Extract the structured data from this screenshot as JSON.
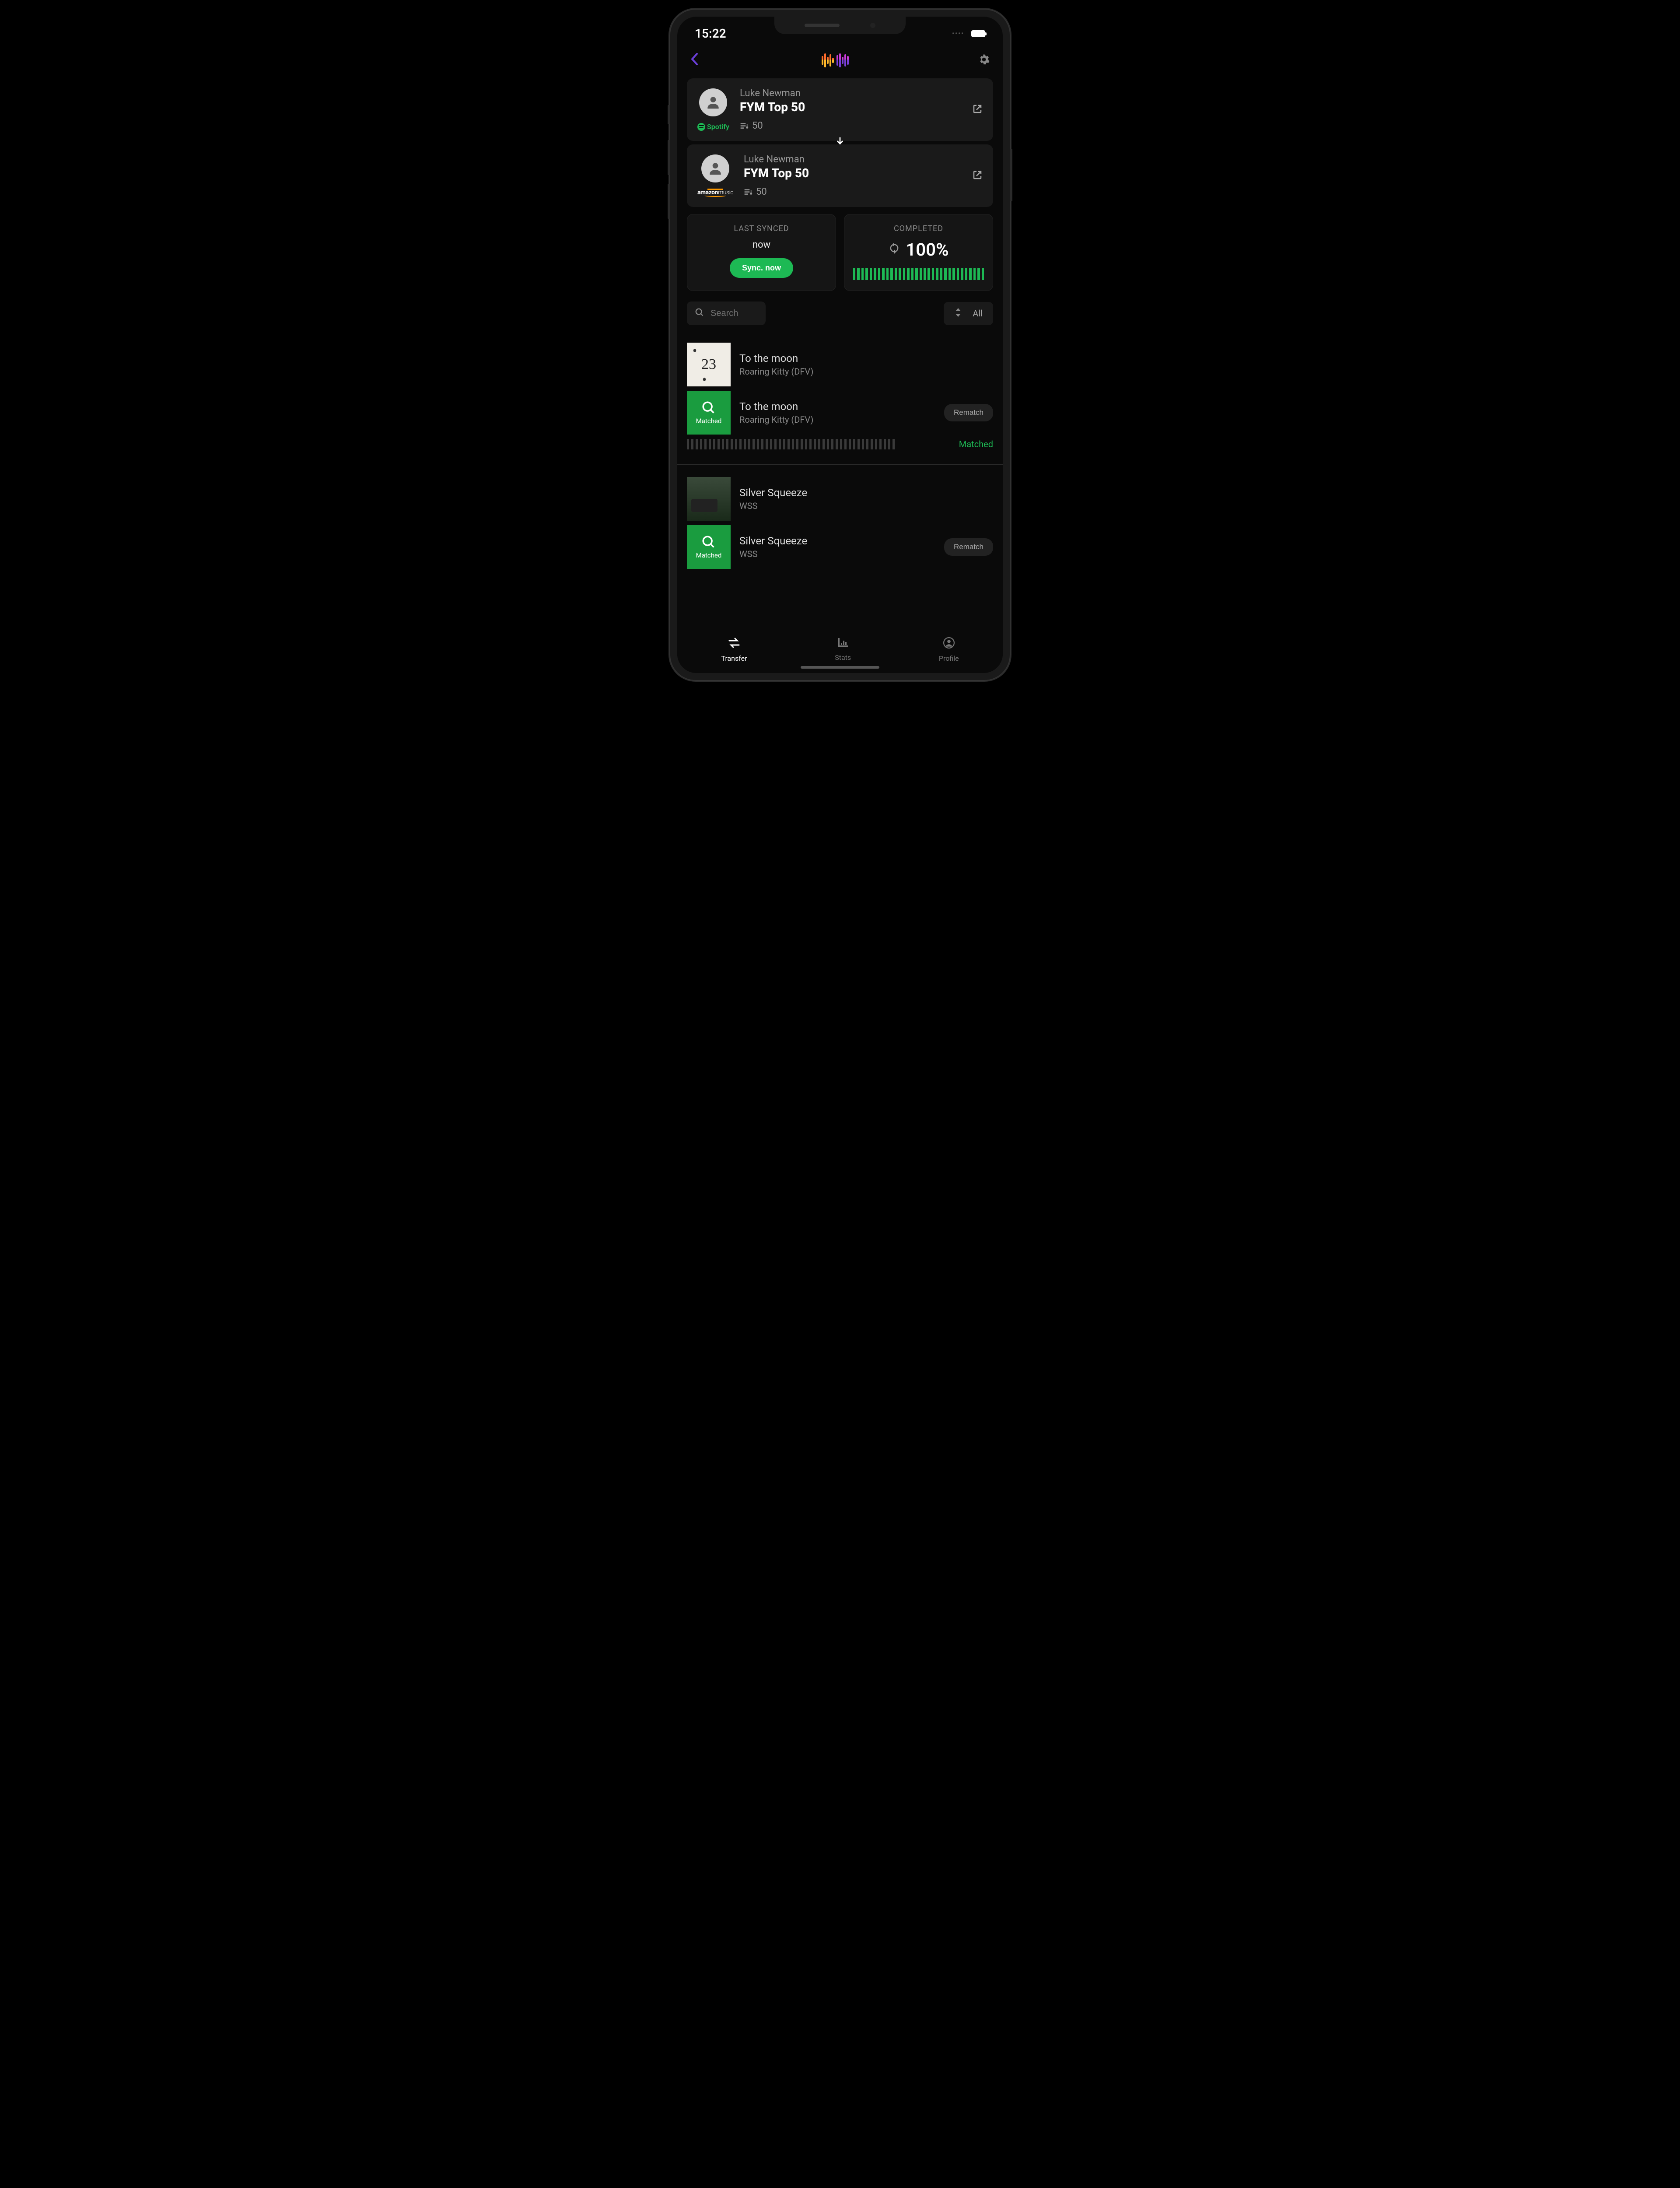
{
  "status_bar": {
    "time": "15:22"
  },
  "source_playlist": {
    "owner": "Luke Newman",
    "name": "FYM Top 50",
    "track_count": "50",
    "service": "Spotify"
  },
  "dest_playlist": {
    "owner": "Luke Newman",
    "name": "FYM Top 50",
    "track_count": "50",
    "service": "amazon music"
  },
  "sync": {
    "last_synced_label": "LAST SYNCED",
    "last_synced_value": "now",
    "sync_button": "Sync. now",
    "completed_label": "COMPLETED",
    "completed_value": "100%"
  },
  "search": {
    "placeholder": "Search",
    "filter_label": "All"
  },
  "tracks": [
    {
      "source": {
        "title": "To the moon",
        "artist": "Roaring Kitty (DFV)"
      },
      "matched": {
        "title": "To the moon",
        "artist": "Roaring Kitty (DFV)",
        "badge": "Matched"
      },
      "rematch_label": "Rematch",
      "status": "Matched"
    },
    {
      "source": {
        "title": "Silver Squeeze",
        "artist": "WSS"
      },
      "matched": {
        "title": "Silver Squeeze",
        "artist": "WSS",
        "badge": "Matched"
      },
      "rematch_label": "Rematch"
    }
  ],
  "tabs": {
    "transfer": "Transfer",
    "stats": "Stats",
    "profile": "Profile"
  }
}
